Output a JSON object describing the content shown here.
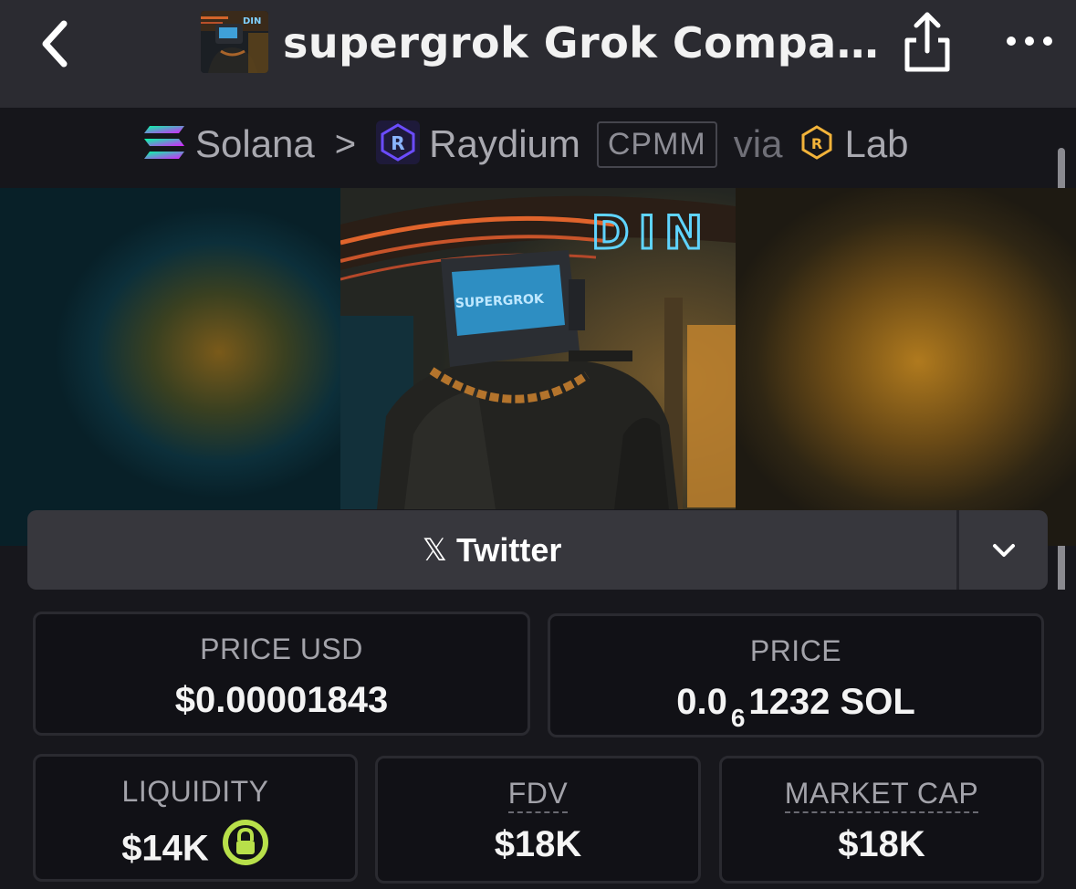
{
  "header": {
    "title": "supergrok Grok Compani…",
    "back_icon": "chevron-left-icon",
    "share_icon": "share-icon",
    "more_icon": "more-horizontal-icon",
    "avatar_text": "DIN"
  },
  "breadcrumb": {
    "chain": "Solana",
    "separator": ">",
    "dex": "Raydium",
    "pool_type": "CPMM",
    "via": "via",
    "launchpad": "Lab"
  },
  "banner": {
    "sign_text": "DIN",
    "screen_text": "SUPERGROK"
  },
  "social": {
    "twitter_label": "Twitter",
    "x_glyph": "𝕏",
    "dropdown_icon": "chevron-down-icon"
  },
  "stats": {
    "price_usd": {
      "label": "PRICE USD",
      "value": "$0.00001843"
    },
    "price": {
      "label": "PRICE",
      "value_prefix": "0.0",
      "zero_count": "6",
      "value_suffix": "1232 SOL"
    },
    "liquidity": {
      "label": "LIQUIDITY",
      "value": "$14K",
      "lock_icon": "lock-icon"
    },
    "fdv": {
      "label": "FDV",
      "value": "$18K"
    },
    "market_cap": {
      "label": "MARKET CAP",
      "value": "$18K"
    }
  },
  "colors": {
    "topbar": "#2b2b31",
    "background": "#17171c",
    "card_border": "#2a2a30",
    "lock_green": "#b8e04a",
    "raydium_purple": "#6b4cff",
    "lab_gold": "#f2b33a"
  }
}
